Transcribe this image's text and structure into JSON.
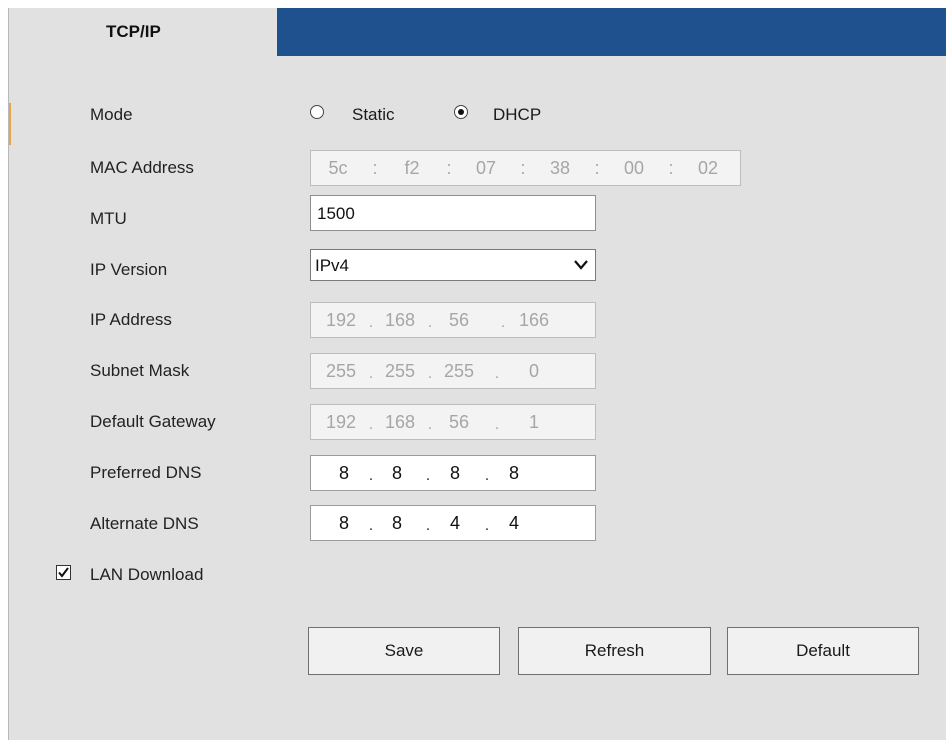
{
  "tab": {
    "label": "TCP/IP"
  },
  "form": {
    "mode": {
      "label": "Mode",
      "options": [
        "Static",
        "DHCP"
      ],
      "selected": "DHCP"
    },
    "mac": {
      "label": "MAC Address",
      "segments": [
        "5c",
        "f2",
        "07",
        "38",
        "00",
        "02"
      ],
      "separator": ":"
    },
    "mtu": {
      "label": "MTU",
      "value": "1500"
    },
    "ip_version": {
      "label": "IP Version",
      "value": "IPv4"
    },
    "ip_address": {
      "label": "IP Address",
      "octets": [
        "192",
        "168",
        "56",
        "166"
      ]
    },
    "subnet_mask": {
      "label": "Subnet Mask",
      "octets": [
        "255",
        "255",
        "255",
        "0"
      ]
    },
    "default_gateway": {
      "label": "Default Gateway",
      "octets": [
        "192",
        "168",
        "56",
        "1"
      ]
    },
    "preferred_dns": {
      "label": "Preferred DNS",
      "octets": [
        "8",
        "8",
        "8",
        "8"
      ]
    },
    "alternate_dns": {
      "label": "Alternate DNS",
      "octets": [
        "8",
        "8",
        "4",
        "4"
      ]
    },
    "lan_download": {
      "label": "LAN Download",
      "checked": true
    },
    "ip_separator": "."
  },
  "buttons": {
    "save": "Save",
    "refresh": "Refresh",
    "default": "Default"
  },
  "colors": {
    "tab_bar": "#1f518e",
    "panel": "#e1e1e1"
  }
}
